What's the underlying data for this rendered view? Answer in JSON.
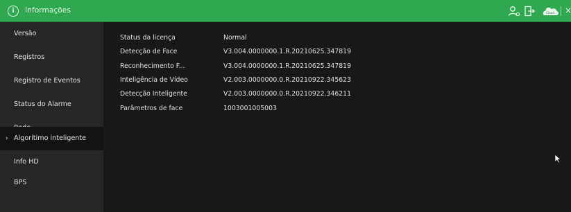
{
  "window": {
    "title": "Informações"
  },
  "toolbar": {
    "icons": [
      "info-icon",
      "user-settings-icon",
      "exit-icon",
      "cloud-icon",
      "close-icon"
    ],
    "cloud_label": "Cloud",
    "close_label": "×"
  },
  "sidebar": {
    "items": [
      {
        "label": "Versão",
        "active": false
      },
      {
        "label": "Registros",
        "active": false
      },
      {
        "label": "Registro de Eventos",
        "active": false
      },
      {
        "label": "Status do Alarme",
        "active": false
      },
      {
        "label": "Rede",
        "active": false
      },
      {
        "label": "Algoritimo inteligente",
        "active": true
      },
      {
        "label": "Info HD",
        "active": false
      },
      {
        "label": "BPS",
        "active": false
      }
    ],
    "active_marker": "›"
  },
  "main": {
    "rows": [
      {
        "key": "Status da licença",
        "value": "Normal"
      },
      {
        "key": "Detecção de Face",
        "value": "V3.004.0000000.1.R.20210625.347819"
      },
      {
        "key": "Reconhecimento F...",
        "value": "V3.004.0000000.1.R.20210625.347819"
      },
      {
        "key": "Inteligência de Vídeo",
        "value": "V2.003.0000000.0.R.20210922.345623"
      },
      {
        "key": "Detecção Inteligente",
        "value": "V2.003.0000000.0.R.20210922.346211"
      },
      {
        "key": "Parâmetros de face",
        "value": "1003001005003"
      }
    ]
  },
  "colors": {
    "titlebar": "#2fa84f",
    "sidebar": "#242627",
    "sidebar_active": "#121314",
    "content": "#161819"
  }
}
